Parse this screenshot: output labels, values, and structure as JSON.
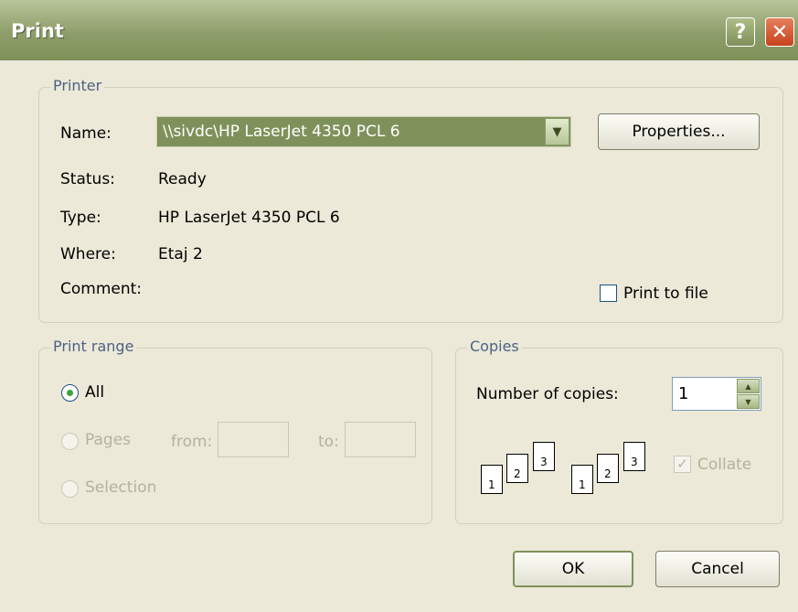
{
  "window": {
    "title": "Print",
    "help_glyph": "?",
    "close_glyph": "✕"
  },
  "printer": {
    "legend": "Printer",
    "name_label": "Name:",
    "name_value": "\\\\sivdc\\HP LaserJet 4350 PCL 6",
    "properties_label": "Properties...",
    "status_label": "Status:",
    "status_value": "Ready",
    "type_label": "Type:",
    "type_value": "HP LaserJet 4350 PCL 6",
    "where_label": "Where:",
    "where_value": "Etaj 2",
    "comment_label": "Comment:",
    "comment_value": "",
    "print_to_file_label": "Print to file",
    "print_to_file_checked": false
  },
  "print_range": {
    "legend": "Print range",
    "all_label": "All",
    "pages_label": "Pages",
    "from_label": "from:",
    "to_label": "to:",
    "selection_label": "Selection",
    "selected": "All"
  },
  "copies": {
    "legend": "Copies",
    "number_label": "Number of copies:",
    "number_value": "1",
    "collate_label": "Collate",
    "collate_checked": true,
    "page_numbers": [
      "1",
      "2",
      "3"
    ]
  },
  "buttons": {
    "ok": "OK",
    "cancel": "Cancel"
  },
  "colors": {
    "accent": "#7f915a",
    "legend_text": "#4d6185",
    "radio_selected": "#3ea23e"
  }
}
